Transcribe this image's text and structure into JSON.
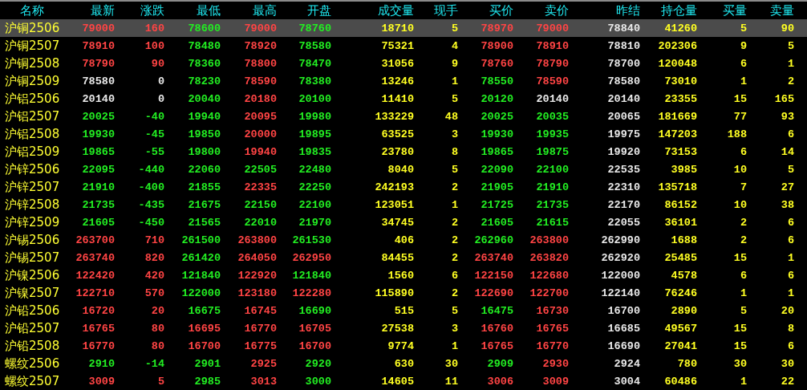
{
  "table": {
    "columns": [
      "名称",
      "最新",
      "涨跌",
      "最低",
      "最高",
      "开盘",
      "成交量",
      "现手",
      "买价",
      "卖价",
      "昨结",
      "持仓量",
      "买量",
      "卖量"
    ],
    "rows": [
      {
        "selected": true,
        "cells": [
          {
            "text": "沪铜2506"
          },
          {
            "text": "79000",
            "color": "#ff4444"
          },
          {
            "text": "160",
            "color": "#ff4444"
          },
          {
            "text": "78600",
            "color": "#22ee22"
          },
          {
            "text": "79000",
            "color": "#ff4444"
          },
          {
            "text": "78760",
            "color": "#22ee22"
          },
          {
            "text": "18710",
            "color": "#ffff22"
          },
          {
            "text": "5",
            "color": "#ffff22"
          },
          {
            "text": "78970",
            "color": "#ff4444"
          },
          {
            "text": "79000",
            "color": "#ff4444"
          },
          {
            "text": "78840",
            "color": "#e8e8e8"
          },
          {
            "text": "41260",
            "color": "#ffff22"
          },
          {
            "text": "5",
            "color": "#ffff22"
          },
          {
            "text": "90",
            "color": "#ffff22"
          }
        ]
      },
      {
        "selected": false,
        "cells": [
          {
            "text": "沪铜2507"
          },
          {
            "text": "78910",
            "color": "#ff4444"
          },
          {
            "text": "100",
            "color": "#ff4444"
          },
          {
            "text": "78480",
            "color": "#22ee22"
          },
          {
            "text": "78920",
            "color": "#ff4444"
          },
          {
            "text": "78580",
            "color": "#22ee22"
          },
          {
            "text": "75321",
            "color": "#ffff22"
          },
          {
            "text": "4",
            "color": "#ffff22"
          },
          {
            "text": "78900",
            "color": "#ff4444"
          },
          {
            "text": "78910",
            "color": "#ff4444"
          },
          {
            "text": "78810",
            "color": "#e8e8e8"
          },
          {
            "text": "202306",
            "color": "#ffff22"
          },
          {
            "text": "9",
            "color": "#ffff22"
          },
          {
            "text": "5",
            "color": "#ffff22"
          }
        ]
      },
      {
        "selected": false,
        "cells": [
          {
            "text": "沪铜2508"
          },
          {
            "text": "78790",
            "color": "#ff4444"
          },
          {
            "text": "90",
            "color": "#ff4444"
          },
          {
            "text": "78360",
            "color": "#22ee22"
          },
          {
            "text": "78800",
            "color": "#ff4444"
          },
          {
            "text": "78470",
            "color": "#22ee22"
          },
          {
            "text": "31056",
            "color": "#ffff22"
          },
          {
            "text": "9",
            "color": "#ffff22"
          },
          {
            "text": "78760",
            "color": "#ff4444"
          },
          {
            "text": "78790",
            "color": "#ff4444"
          },
          {
            "text": "78700",
            "color": "#e8e8e8"
          },
          {
            "text": "120048",
            "color": "#ffff22"
          },
          {
            "text": "6",
            "color": "#ffff22"
          },
          {
            "text": "1",
            "color": "#ffff22"
          }
        ]
      },
      {
        "selected": false,
        "cells": [
          {
            "text": "沪铜2509"
          },
          {
            "text": "78580",
            "color": "#e8e8e8"
          },
          {
            "text": "0",
            "color": "#e8e8e8"
          },
          {
            "text": "78230",
            "color": "#22ee22"
          },
          {
            "text": "78590",
            "color": "#ff4444"
          },
          {
            "text": "78380",
            "color": "#22ee22"
          },
          {
            "text": "13246",
            "color": "#ffff22"
          },
          {
            "text": "1",
            "color": "#ffff22"
          },
          {
            "text": "78550",
            "color": "#22ee22"
          },
          {
            "text": "78590",
            "color": "#ff4444"
          },
          {
            "text": "78580",
            "color": "#e8e8e8"
          },
          {
            "text": "73010",
            "color": "#ffff22"
          },
          {
            "text": "1",
            "color": "#ffff22"
          },
          {
            "text": "2",
            "color": "#ffff22"
          }
        ]
      },
      {
        "selected": false,
        "cells": [
          {
            "text": "沪铝2506"
          },
          {
            "text": "20140",
            "color": "#e8e8e8"
          },
          {
            "text": "0",
            "color": "#e8e8e8"
          },
          {
            "text": "20040",
            "color": "#22ee22"
          },
          {
            "text": "20180",
            "color": "#ff4444"
          },
          {
            "text": "20100",
            "color": "#22ee22"
          },
          {
            "text": "11410",
            "color": "#ffff22"
          },
          {
            "text": "5",
            "color": "#ffff22"
          },
          {
            "text": "20120",
            "color": "#22ee22"
          },
          {
            "text": "20140",
            "color": "#e8e8e8"
          },
          {
            "text": "20140",
            "color": "#e8e8e8"
          },
          {
            "text": "23355",
            "color": "#ffff22"
          },
          {
            "text": "15",
            "color": "#ffff22"
          },
          {
            "text": "165",
            "color": "#ffff22"
          }
        ]
      },
      {
        "selected": false,
        "cells": [
          {
            "text": "沪铝2507"
          },
          {
            "text": "20025",
            "color": "#22ee22"
          },
          {
            "text": "-40",
            "color": "#22ee22"
          },
          {
            "text": "19940",
            "color": "#22ee22"
          },
          {
            "text": "20095",
            "color": "#ff4444"
          },
          {
            "text": "19980",
            "color": "#22ee22"
          },
          {
            "text": "133229",
            "color": "#ffff22"
          },
          {
            "text": "48",
            "color": "#ffff22"
          },
          {
            "text": "20025",
            "color": "#22ee22"
          },
          {
            "text": "20035",
            "color": "#22ee22"
          },
          {
            "text": "20065",
            "color": "#e8e8e8"
          },
          {
            "text": "181669",
            "color": "#ffff22"
          },
          {
            "text": "77",
            "color": "#ffff22"
          },
          {
            "text": "93",
            "color": "#ffff22"
          }
        ]
      },
      {
        "selected": false,
        "cells": [
          {
            "text": "沪铝2508"
          },
          {
            "text": "19930",
            "color": "#22ee22"
          },
          {
            "text": "-45",
            "color": "#22ee22"
          },
          {
            "text": "19850",
            "color": "#22ee22"
          },
          {
            "text": "20000",
            "color": "#ff4444"
          },
          {
            "text": "19895",
            "color": "#22ee22"
          },
          {
            "text": "63525",
            "color": "#ffff22"
          },
          {
            "text": "3",
            "color": "#ffff22"
          },
          {
            "text": "19930",
            "color": "#22ee22"
          },
          {
            "text": "19935",
            "color": "#22ee22"
          },
          {
            "text": "19975",
            "color": "#e8e8e8"
          },
          {
            "text": "147203",
            "color": "#ffff22"
          },
          {
            "text": "188",
            "color": "#ffff22"
          },
          {
            "text": "6",
            "color": "#ffff22"
          }
        ]
      },
      {
        "selected": false,
        "cells": [
          {
            "text": "沪铝2509"
          },
          {
            "text": "19865",
            "color": "#22ee22"
          },
          {
            "text": "-55",
            "color": "#22ee22"
          },
          {
            "text": "19800",
            "color": "#22ee22"
          },
          {
            "text": "19940",
            "color": "#ff4444"
          },
          {
            "text": "19835",
            "color": "#22ee22"
          },
          {
            "text": "23780",
            "color": "#ffff22"
          },
          {
            "text": "8",
            "color": "#ffff22"
          },
          {
            "text": "19865",
            "color": "#22ee22"
          },
          {
            "text": "19875",
            "color": "#22ee22"
          },
          {
            "text": "19920",
            "color": "#e8e8e8"
          },
          {
            "text": "73153",
            "color": "#ffff22"
          },
          {
            "text": "6",
            "color": "#ffff22"
          },
          {
            "text": "14",
            "color": "#ffff22"
          }
        ]
      },
      {
        "selected": false,
        "cells": [
          {
            "text": "沪锌2506"
          },
          {
            "text": "22095",
            "color": "#22ee22"
          },
          {
            "text": "-440",
            "color": "#22ee22"
          },
          {
            "text": "22060",
            "color": "#22ee22"
          },
          {
            "text": "22505",
            "color": "#22ee22"
          },
          {
            "text": "22480",
            "color": "#22ee22"
          },
          {
            "text": "8040",
            "color": "#ffff22"
          },
          {
            "text": "5",
            "color": "#ffff22"
          },
          {
            "text": "22090",
            "color": "#22ee22"
          },
          {
            "text": "22100",
            "color": "#22ee22"
          },
          {
            "text": "22535",
            "color": "#e8e8e8"
          },
          {
            "text": "3985",
            "color": "#ffff22"
          },
          {
            "text": "10",
            "color": "#ffff22"
          },
          {
            "text": "5",
            "color": "#ffff22"
          }
        ]
      },
      {
        "selected": false,
        "cells": [
          {
            "text": "沪锌2507"
          },
          {
            "text": "21910",
            "color": "#22ee22"
          },
          {
            "text": "-400",
            "color": "#22ee22"
          },
          {
            "text": "21855",
            "color": "#22ee22"
          },
          {
            "text": "22335",
            "color": "#ff4444"
          },
          {
            "text": "22250",
            "color": "#22ee22"
          },
          {
            "text": "242193",
            "color": "#ffff22"
          },
          {
            "text": "2",
            "color": "#ffff22"
          },
          {
            "text": "21905",
            "color": "#22ee22"
          },
          {
            "text": "21910",
            "color": "#22ee22"
          },
          {
            "text": "22310",
            "color": "#e8e8e8"
          },
          {
            "text": "135718",
            "color": "#ffff22"
          },
          {
            "text": "7",
            "color": "#ffff22"
          },
          {
            "text": "27",
            "color": "#ffff22"
          }
        ]
      },
      {
        "selected": false,
        "cells": [
          {
            "text": "沪锌2508"
          },
          {
            "text": "21735",
            "color": "#22ee22"
          },
          {
            "text": "-435",
            "color": "#22ee22"
          },
          {
            "text": "21675",
            "color": "#22ee22"
          },
          {
            "text": "22150",
            "color": "#22ee22"
          },
          {
            "text": "22100",
            "color": "#22ee22"
          },
          {
            "text": "123051",
            "color": "#ffff22"
          },
          {
            "text": "1",
            "color": "#ffff22"
          },
          {
            "text": "21725",
            "color": "#22ee22"
          },
          {
            "text": "21735",
            "color": "#22ee22"
          },
          {
            "text": "22170",
            "color": "#e8e8e8"
          },
          {
            "text": "86152",
            "color": "#ffff22"
          },
          {
            "text": "10",
            "color": "#ffff22"
          },
          {
            "text": "38",
            "color": "#ffff22"
          }
        ]
      },
      {
        "selected": false,
        "cells": [
          {
            "text": "沪锌2509"
          },
          {
            "text": "21605",
            "color": "#22ee22"
          },
          {
            "text": "-450",
            "color": "#22ee22"
          },
          {
            "text": "21565",
            "color": "#22ee22"
          },
          {
            "text": "22010",
            "color": "#22ee22"
          },
          {
            "text": "21970",
            "color": "#22ee22"
          },
          {
            "text": "34745",
            "color": "#ffff22"
          },
          {
            "text": "2",
            "color": "#ffff22"
          },
          {
            "text": "21605",
            "color": "#22ee22"
          },
          {
            "text": "21615",
            "color": "#22ee22"
          },
          {
            "text": "22055",
            "color": "#e8e8e8"
          },
          {
            "text": "36101",
            "color": "#ffff22"
          },
          {
            "text": "2",
            "color": "#ffff22"
          },
          {
            "text": "6",
            "color": "#ffff22"
          }
        ]
      },
      {
        "selected": false,
        "cells": [
          {
            "text": "沪锡2506"
          },
          {
            "text": "263700",
            "color": "#ff4444"
          },
          {
            "text": "710",
            "color": "#ff4444"
          },
          {
            "text": "261500",
            "color": "#22ee22"
          },
          {
            "text": "263800",
            "color": "#ff4444"
          },
          {
            "text": "261530",
            "color": "#22ee22"
          },
          {
            "text": "406",
            "color": "#ffff22"
          },
          {
            "text": "2",
            "color": "#ffff22"
          },
          {
            "text": "262960",
            "color": "#22ee22"
          },
          {
            "text": "263800",
            "color": "#ff4444"
          },
          {
            "text": "262990",
            "color": "#e8e8e8"
          },
          {
            "text": "1688",
            "color": "#ffff22"
          },
          {
            "text": "2",
            "color": "#ffff22"
          },
          {
            "text": "6",
            "color": "#ffff22"
          }
        ]
      },
      {
        "selected": false,
        "cells": [
          {
            "text": "沪锡2507"
          },
          {
            "text": "263740",
            "color": "#ff4444"
          },
          {
            "text": "820",
            "color": "#ff4444"
          },
          {
            "text": "261420",
            "color": "#22ee22"
          },
          {
            "text": "264050",
            "color": "#ff4444"
          },
          {
            "text": "262950",
            "color": "#ff4444"
          },
          {
            "text": "84455",
            "color": "#ffff22"
          },
          {
            "text": "2",
            "color": "#ffff22"
          },
          {
            "text": "263740",
            "color": "#ff4444"
          },
          {
            "text": "263820",
            "color": "#ff4444"
          },
          {
            "text": "262920",
            "color": "#e8e8e8"
          },
          {
            "text": "25485",
            "color": "#ffff22"
          },
          {
            "text": "15",
            "color": "#ffff22"
          },
          {
            "text": "1",
            "color": "#ffff22"
          }
        ]
      },
      {
        "selected": false,
        "cells": [
          {
            "text": "沪镍2506"
          },
          {
            "text": "122420",
            "color": "#ff4444"
          },
          {
            "text": "420",
            "color": "#ff4444"
          },
          {
            "text": "121840",
            "color": "#22ee22"
          },
          {
            "text": "122920",
            "color": "#ff4444"
          },
          {
            "text": "121840",
            "color": "#22ee22"
          },
          {
            "text": "1560",
            "color": "#ffff22"
          },
          {
            "text": "6",
            "color": "#ffff22"
          },
          {
            "text": "122150",
            "color": "#ff4444"
          },
          {
            "text": "122680",
            "color": "#ff4444"
          },
          {
            "text": "122000",
            "color": "#e8e8e8"
          },
          {
            "text": "4578",
            "color": "#ffff22"
          },
          {
            "text": "6",
            "color": "#ffff22"
          },
          {
            "text": "6",
            "color": "#ffff22"
          }
        ]
      },
      {
        "selected": false,
        "cells": [
          {
            "text": "沪镍2507"
          },
          {
            "text": "122710",
            "color": "#ff4444"
          },
          {
            "text": "570",
            "color": "#ff4444"
          },
          {
            "text": "122000",
            "color": "#22ee22"
          },
          {
            "text": "123180",
            "color": "#ff4444"
          },
          {
            "text": "122280",
            "color": "#ff4444"
          },
          {
            "text": "115890",
            "color": "#ffff22"
          },
          {
            "text": "2",
            "color": "#ffff22"
          },
          {
            "text": "122690",
            "color": "#ff4444"
          },
          {
            "text": "122700",
            "color": "#ff4444"
          },
          {
            "text": "122140",
            "color": "#e8e8e8"
          },
          {
            "text": "76246",
            "color": "#ffff22"
          },
          {
            "text": "1",
            "color": "#ffff22"
          },
          {
            "text": "1",
            "color": "#ffff22"
          }
        ]
      },
      {
        "selected": false,
        "cells": [
          {
            "text": "沪铅2506"
          },
          {
            "text": "16720",
            "color": "#ff4444"
          },
          {
            "text": "20",
            "color": "#ff4444"
          },
          {
            "text": "16675",
            "color": "#22ee22"
          },
          {
            "text": "16745",
            "color": "#ff4444"
          },
          {
            "text": "16690",
            "color": "#22ee22"
          },
          {
            "text": "515",
            "color": "#ffff22"
          },
          {
            "text": "5",
            "color": "#ffff22"
          },
          {
            "text": "16475",
            "color": "#22ee22"
          },
          {
            "text": "16730",
            "color": "#ff4444"
          },
          {
            "text": "16700",
            "color": "#e8e8e8"
          },
          {
            "text": "2890",
            "color": "#ffff22"
          },
          {
            "text": "5",
            "color": "#ffff22"
          },
          {
            "text": "20",
            "color": "#ffff22"
          }
        ]
      },
      {
        "selected": false,
        "cells": [
          {
            "text": "沪铅2507"
          },
          {
            "text": "16765",
            "color": "#ff4444"
          },
          {
            "text": "80",
            "color": "#ff4444"
          },
          {
            "text": "16695",
            "color": "#ff4444"
          },
          {
            "text": "16770",
            "color": "#ff4444"
          },
          {
            "text": "16705",
            "color": "#ff4444"
          },
          {
            "text": "27538",
            "color": "#ffff22"
          },
          {
            "text": "3",
            "color": "#ffff22"
          },
          {
            "text": "16760",
            "color": "#ff4444"
          },
          {
            "text": "16765",
            "color": "#ff4444"
          },
          {
            "text": "16685",
            "color": "#e8e8e8"
          },
          {
            "text": "49567",
            "color": "#ffff22"
          },
          {
            "text": "15",
            "color": "#ffff22"
          },
          {
            "text": "8",
            "color": "#ffff22"
          }
        ]
      },
      {
        "selected": false,
        "cells": [
          {
            "text": "沪铅2508"
          },
          {
            "text": "16770",
            "color": "#ff4444"
          },
          {
            "text": "80",
            "color": "#ff4444"
          },
          {
            "text": "16700",
            "color": "#ff4444"
          },
          {
            "text": "16775",
            "color": "#ff4444"
          },
          {
            "text": "16700",
            "color": "#ff4444"
          },
          {
            "text": "9774",
            "color": "#ffff22"
          },
          {
            "text": "1",
            "color": "#ffff22"
          },
          {
            "text": "16765",
            "color": "#ff4444"
          },
          {
            "text": "16770",
            "color": "#ff4444"
          },
          {
            "text": "16690",
            "color": "#e8e8e8"
          },
          {
            "text": "27041",
            "color": "#ffff22"
          },
          {
            "text": "15",
            "color": "#ffff22"
          },
          {
            "text": "6",
            "color": "#ffff22"
          }
        ]
      },
      {
        "selected": false,
        "cells": [
          {
            "text": "螺纹2506"
          },
          {
            "text": "2910",
            "color": "#22ee22"
          },
          {
            "text": "-14",
            "color": "#22ee22"
          },
          {
            "text": "2901",
            "color": "#22ee22"
          },
          {
            "text": "2925",
            "color": "#ff4444"
          },
          {
            "text": "2920",
            "color": "#22ee22"
          },
          {
            "text": "630",
            "color": "#ffff22"
          },
          {
            "text": "30",
            "color": "#ffff22"
          },
          {
            "text": "2909",
            "color": "#22ee22"
          },
          {
            "text": "2930",
            "color": "#ff4444"
          },
          {
            "text": "2924",
            "color": "#e8e8e8"
          },
          {
            "text": "780",
            "color": "#ffff22"
          },
          {
            "text": "30",
            "color": "#ffff22"
          },
          {
            "text": "30",
            "color": "#ffff22"
          }
        ]
      },
      {
        "selected": false,
        "cells": [
          {
            "text": "螺纹2507"
          },
          {
            "text": "3009",
            "color": "#ff4444"
          },
          {
            "text": "5",
            "color": "#ff4444"
          },
          {
            "text": "2985",
            "color": "#22ee22"
          },
          {
            "text": "3013",
            "color": "#ff4444"
          },
          {
            "text": "3000",
            "color": "#22ee22"
          },
          {
            "text": "14605",
            "color": "#ffff22"
          },
          {
            "text": "11",
            "color": "#ffff22"
          },
          {
            "text": "3006",
            "color": "#ff4444"
          },
          {
            "text": "3009",
            "color": "#ff4444"
          },
          {
            "text": "3004",
            "color": "#e8e8e8"
          },
          {
            "text": "60486",
            "color": "#ffff22"
          },
          {
            "text": "1",
            "color": "#ffff22"
          },
          {
            "text": "22",
            "color": "#ffff22"
          }
        ]
      }
    ]
  }
}
